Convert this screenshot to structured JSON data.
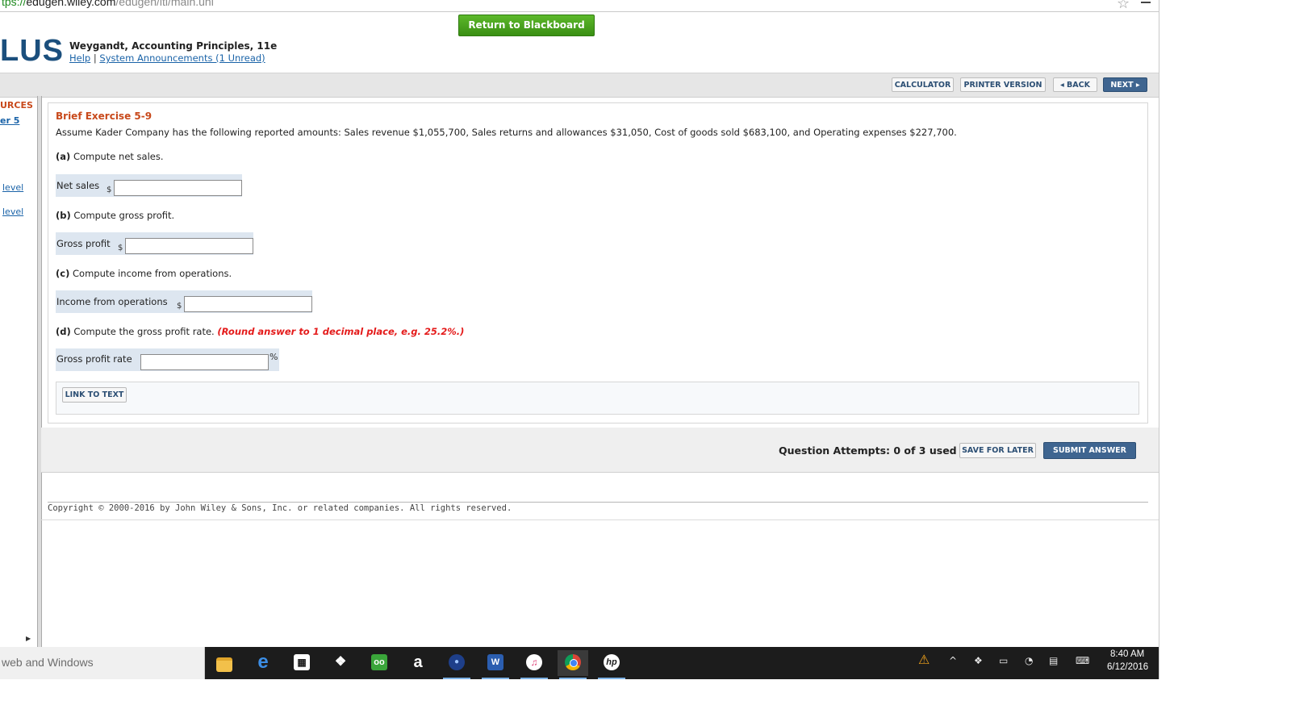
{
  "browser": {
    "url_scheme": "tps://",
    "url_host": "edugen.wiley.com",
    "url_path": "/edugen/lti/main.uni"
  },
  "header": {
    "return_button": "Return to Blackboard",
    "logo": "LUS",
    "book_title": "Weygandt, Accounting Principles, 11e",
    "help_link": "Help",
    "separator": "|",
    "announcements_link": "System Announcements (1 Unread)"
  },
  "toolbar": {
    "calculator": "CALCULATOR",
    "printer_version": "PRINTER VERSION",
    "back": "◂ BACK",
    "next": "NEXT ▸"
  },
  "sidebar": {
    "items": [
      "URCES",
      "er 5",
      "level",
      "level"
    ]
  },
  "question": {
    "title": "Brief Exercise 5-9",
    "intro": "Assume Kader Company has the following reported amounts: Sales revenue $1,055,700, Sales returns and allowances $31,050, Cost of goods sold $683,100, and Operating expenses $227,700.",
    "parts": [
      {
        "letter": "(a)",
        "text": "Compute net sales.",
        "label": "Net sales",
        "prefix": "$",
        "value": ""
      },
      {
        "letter": "(b)",
        "text": "Compute gross profit.",
        "label": "Gross profit",
        "prefix": "$",
        "value": ""
      },
      {
        "letter": "(c)",
        "text": "Compute income from operations.",
        "label": "Income from operations",
        "prefix": "$",
        "value": ""
      },
      {
        "letter": "(d)",
        "text": "Compute the gross profit rate.",
        "note": "(Round answer to 1 decimal place, e.g. 25.2%.)",
        "label": "Gross profit rate",
        "suffix": "%",
        "value": ""
      }
    ],
    "link_to_text": "LINK TO TEXT"
  },
  "submit": {
    "attempts": "Question Attempts: 0 of 3 used",
    "save_for_later": "SAVE FOR LATER",
    "submit_answer": "SUBMIT ANSWER"
  },
  "footer": {
    "copyright": "Copyright © 2000-2016 by John Wiley & Sons, Inc. or related companies. All rights reserved."
  },
  "taskbar": {
    "search_text": "web and Windows",
    "apps": [
      "file-explorer-icon",
      "edge-icon",
      "store-icon",
      "dropbox-icon",
      "tripadvisor-icon",
      "amazon-icon",
      "media-player-icon",
      "word-icon",
      "itunes-icon",
      "chrome-icon",
      "hp-icon"
    ],
    "clock_time": "8:40 AM",
    "clock_date": "6/12/2016"
  },
  "colors": {
    "return_green": "#3a8f14",
    "brand_blue": "#1b4f7d",
    "exercise_title": "#c8491b",
    "note_red": "#e41b1b",
    "primary_button": "#3f6590"
  }
}
